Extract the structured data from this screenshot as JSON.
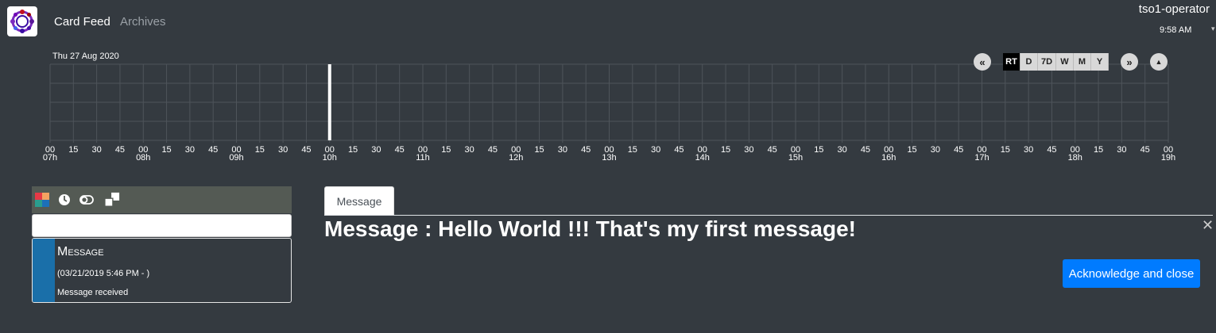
{
  "header": {
    "nav": [
      "Card Feed",
      "Archives"
    ],
    "user": "tso1-operator",
    "time": "9:58 AM",
    "caret": "▾"
  },
  "timeline": {
    "date": "Thu 27 Aug 2020",
    "prev": "«",
    "next": "»",
    "collapse": "▲",
    "ranges": [
      "RT",
      "D",
      "7D",
      "W",
      "M",
      "Y"
    ],
    "active_range": "RT",
    "hours": [
      "07h",
      "08h",
      "09h",
      "10h",
      "11h",
      "12h",
      "13h",
      "14h",
      "15h",
      "16h",
      "17h",
      "18h",
      "19h"
    ],
    "minutes": [
      "00",
      "15",
      "30",
      "45"
    ],
    "current_time_position_hours": 3
  },
  "feed": {
    "toolbar_icons": [
      "color-filter-icon",
      "clock-icon",
      "toggle-icon",
      "windows-icon"
    ],
    "search_value": "",
    "cards": [
      {
        "title": "Message",
        "date": "(03/21/2019 5:46 PM - )",
        "summary": "Message received",
        "color": "#1a6fa9"
      }
    ]
  },
  "detail": {
    "tab": "Message",
    "title": "Message : Hello World !!! That's my first message!",
    "close": "✕",
    "ack_label": "Acknowledge and close",
    "ack_color": "#007bff"
  }
}
